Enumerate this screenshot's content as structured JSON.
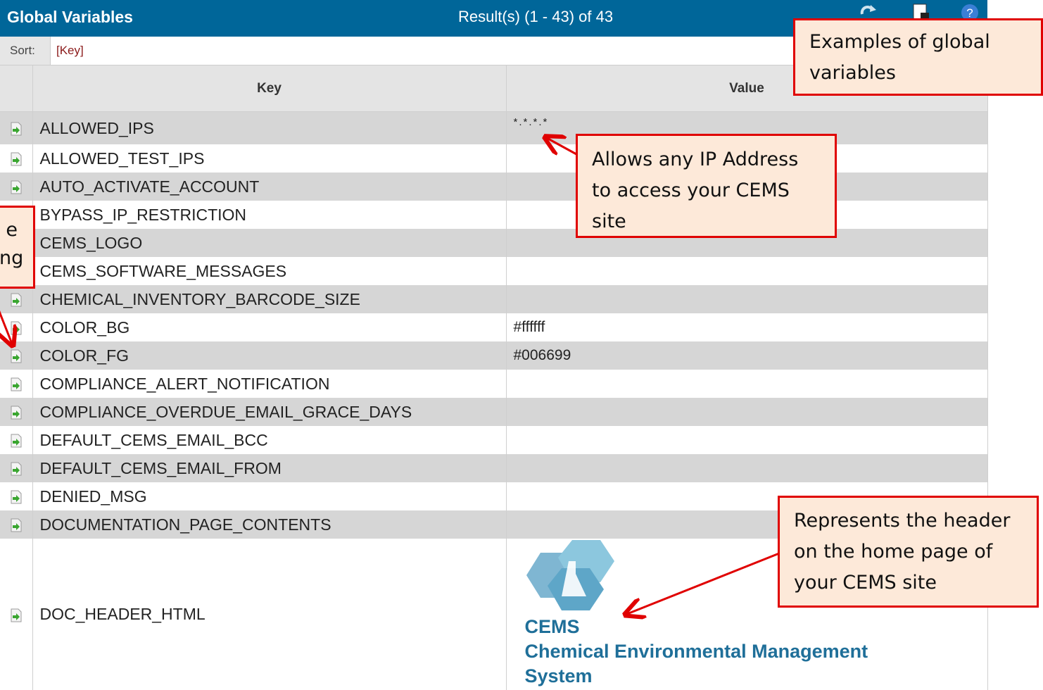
{
  "header": {
    "title": "Global Variables",
    "results": "Result(s) (1 - 43) of 43"
  },
  "sort": {
    "label": "Sort:",
    "key": "[Key]"
  },
  "table": {
    "columns": [
      "Key",
      "Value"
    ],
    "rows": [
      {
        "key": "ALLOWED_IPS",
        "value": "*.*.*.*"
      },
      {
        "key": "ALLOWED_TEST_IPS",
        "value": ""
      },
      {
        "key": "AUTO_ACTIVATE_ACCOUNT",
        "value": ""
      },
      {
        "key": "BYPASS_IP_RESTRICTION",
        "value": ""
      },
      {
        "key": "CEMS_LOGO",
        "value": ""
      },
      {
        "key": "CEMS_SOFTWARE_MESSAGES",
        "value": ""
      },
      {
        "key": "CHEMICAL_INVENTORY_BARCODE_SIZE",
        "value": ""
      },
      {
        "key": "COLOR_BG",
        "value": "#ffffff"
      },
      {
        "key": "COLOR_FG",
        "value": "#006699"
      },
      {
        "key": "COMPLIANCE_ALERT_NOTIFICATION",
        "value": ""
      },
      {
        "key": "COMPLIANCE_OVERDUE_EMAIL_GRACE_DAYS",
        "value": ""
      },
      {
        "key": "DEFAULT_CEMS_EMAIL_BCC",
        "value": ""
      },
      {
        "key": "DEFAULT_CEMS_EMAIL_FROM",
        "value": ""
      },
      {
        "key": "DENIED_MSG",
        "value": ""
      },
      {
        "key": "DOCUMENTATION_PAGE_CONTENTS",
        "value": ""
      },
      {
        "key": "DOC_HEADER_HTML",
        "value": ""
      }
    ]
  },
  "logo": {
    "line1": "CEMS",
    "line2": "Chemical Environmental Management",
    "line3": "System"
  },
  "callouts": {
    "examples": "Examples of global variables",
    "allows": "Allows any IP Address to access your CEMS site",
    "represents": "Represents the header on the home page of your CEMS site",
    "left_partial_1": "e",
    "left_partial_2": "ng"
  },
  "colors": {
    "header_bg": "#006699",
    "row_shade": "#d6d6d6",
    "callout_fill": "#fde9d9",
    "callout_border": "#e00000",
    "logo_blue": "#1f6f99"
  },
  "icons": [
    "refresh-icon",
    "export-icon",
    "help-icon",
    "row-arrow-icon",
    "cems-logo-icon"
  ]
}
